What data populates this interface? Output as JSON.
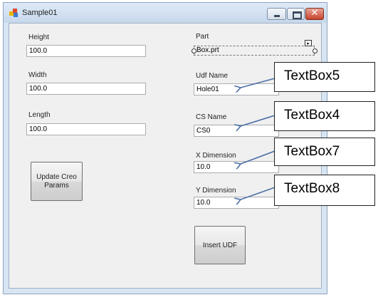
{
  "window": {
    "title": "Sample01",
    "accent": "#c8422b",
    "close_glyph": "✕"
  },
  "left_fields": [
    {
      "label": "Height",
      "value": "100.0"
    },
    {
      "label": "Width",
      "value": "100.0"
    },
    {
      "label": "Length",
      "value": "100.0"
    }
  ],
  "update_button_label": "Update Creo Params",
  "part": {
    "label": "Part",
    "value": "Box.prt",
    "smart_tag_glyph": "▸"
  },
  "right_fields": [
    {
      "label": "Udf Name",
      "value": "Hole01"
    },
    {
      "label": "CS Name",
      "value": "CS0"
    },
    {
      "label": "X Dimension",
      "value": "10.0"
    },
    {
      "label": "Y Dimension",
      "value": "10.0"
    }
  ],
  "insert_button_label": "Insert UDF",
  "callouts": [
    "TextBox5",
    "TextBox4",
    "TextBox7",
    "TextBox8"
  ],
  "arrow_color": "#4a6fa5"
}
